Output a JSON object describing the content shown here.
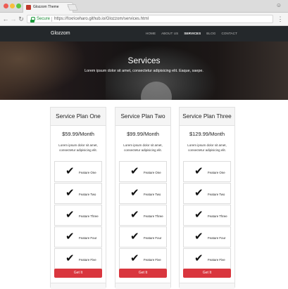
{
  "browser": {
    "tab_title": "Glozzom Theme",
    "tab_close": "×",
    "secure_label": "Secure",
    "url": "https://foxriceharo.github.io/Glozzom/services.html",
    "nav_back": "←",
    "nav_forward": "→",
    "nav_reload": "↻",
    "menu": "⋮",
    "user": "☺",
    "window_buttons": [
      "#ee5c54",
      "#f8be3a",
      "#5cc63f"
    ]
  },
  "navbar": {
    "brand": "Glozzom",
    "links": [
      {
        "label": "HOME",
        "active": false
      },
      {
        "label": "ABOUT US",
        "active": false
      },
      {
        "label": "SERVICES",
        "active": true
      },
      {
        "label": "BLOG",
        "active": false
      },
      {
        "label": "CONTACT",
        "active": false
      }
    ]
  },
  "hero": {
    "title": "Services",
    "subtitle": "Lorem ipsum dolor sit amet, consectetur adipisicing elit. Eaque, saepe."
  },
  "plans": [
    {
      "name": "Service Plan One",
      "price": "$59.99/Month",
      "description": "Lorem ipsum dolor sit amet, consectetur adipisicing elit.",
      "features": [
        "Feature One",
        "Feature Two",
        "Feature Three",
        "Feature Four",
        "Feature Five"
      ],
      "button": "Get It"
    },
    {
      "name": "Service Plan Two",
      "price": "$99.99/Month",
      "description": "Lorem ipsum dolor sit amet, consectetur adipisicing elit.",
      "features": [
        "Feature One",
        "Feature Two",
        "Feature Three",
        "Feature Four",
        "Feature Five"
      ],
      "button": "Get It"
    },
    {
      "name": "Service Plan Three",
      "price": "$129.99/Month",
      "description": "Lorem ipsum dolor sit amet, consectetur adipisicing elit.",
      "features": [
        "Feature One",
        "Feature Two",
        "Feature Three",
        "Feature Four",
        "Feature Five"
      ],
      "button": "Get It"
    }
  ],
  "icons": {
    "check": "✔"
  },
  "colors": {
    "navbar_bg": "#24282b",
    "button_bg": "#d9363e",
    "secure_green": "#1a8a35"
  }
}
